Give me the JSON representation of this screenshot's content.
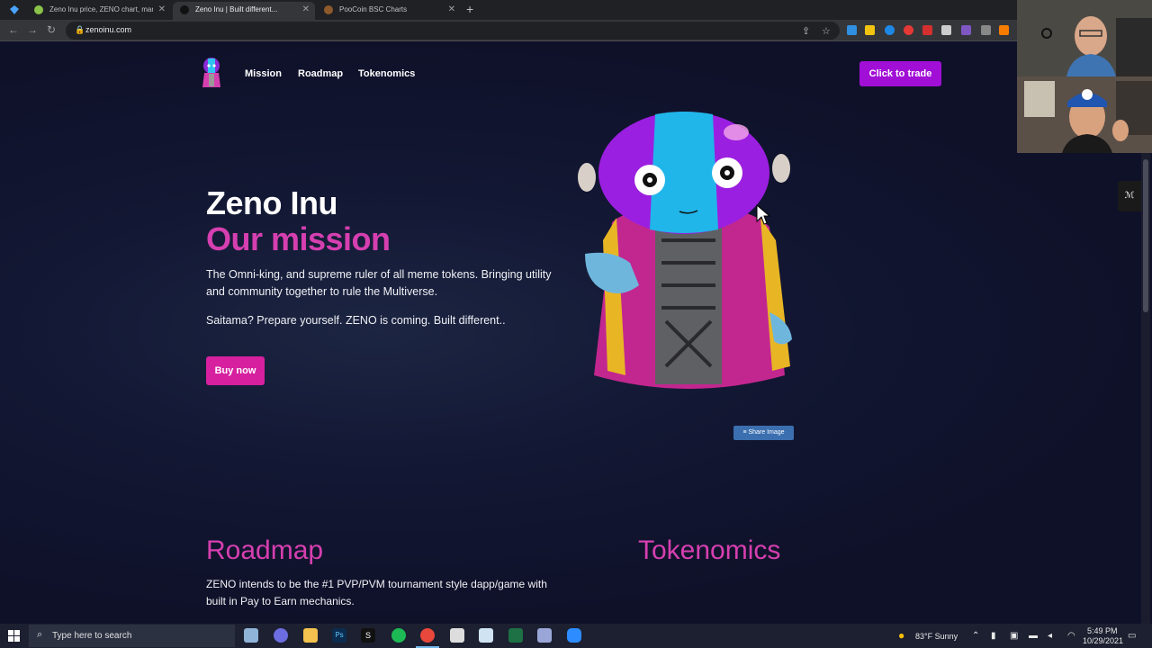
{
  "browser": {
    "tabs": [
      {
        "title": "Zeno Inu price, ZENO chart, mark",
        "active": false
      },
      {
        "title": "Zeno Inu | Built different...",
        "active": true
      },
      {
        "title": "PooCoin BSC Charts",
        "active": false
      }
    ],
    "url": "zenoinu.com"
  },
  "site": {
    "nav": {
      "mission": "Mission",
      "roadmap": "Roadmap",
      "tokenomics": "Tokenomics",
      "trade": "Click to trade"
    },
    "hero": {
      "title": "Zeno Inu",
      "subtitle": "Our mission",
      "para1": "The Omni-king, and supreme ruler of all meme tokens. Bringing utility and community together to rule the Multiverse.",
      "para2": "Saitama? Prepare yourself. ZENO is coming. Built different..",
      "buy": "Buy now",
      "share": "Share Image"
    },
    "roadmap": {
      "title": "Roadmap",
      "text": "ZENO intends to be the #1 PVP/PVM tournament style dapp/game with built in Pay to Earn mechanics."
    },
    "tokenomics": {
      "title": "Tokenomics"
    }
  },
  "taskbar": {
    "search_placeholder": "Type here to search",
    "weather": "83°F  Sunny",
    "time": "5:49 PM",
    "date": "10/29/2021"
  },
  "colors": {
    "brand_pink": "#d63fb0",
    "trade_purple": "#a10fd6",
    "page_bg": "#0f1129"
  }
}
